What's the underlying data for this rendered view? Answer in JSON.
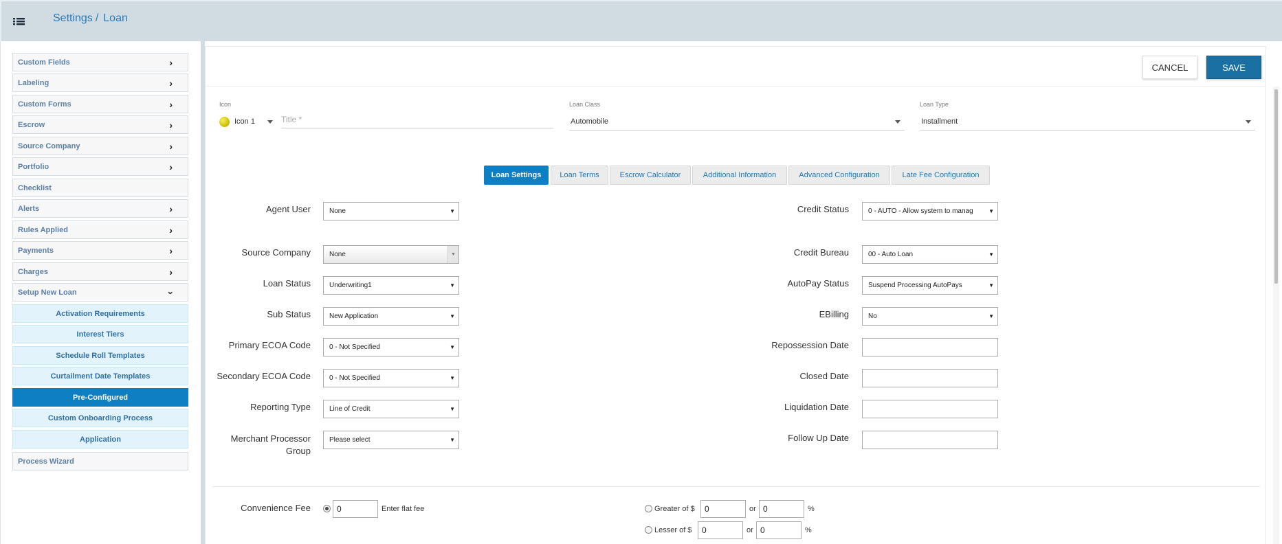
{
  "header": {
    "breadcrumb": [
      "Settings",
      "Loan"
    ],
    "breadcrumb_sep": "/"
  },
  "sidebar": {
    "items": [
      {
        "label": "Custom Fields",
        "chevron": "right"
      },
      {
        "label": "Labeling",
        "chevron": "right"
      },
      {
        "label": "Custom Forms",
        "chevron": "right"
      },
      {
        "label": "Escrow",
        "chevron": "right"
      },
      {
        "label": "Source Company",
        "chevron": "right"
      },
      {
        "label": "Portfolio",
        "chevron": "right"
      },
      {
        "label": "Checklist",
        "chevron": ""
      },
      {
        "label": "Alerts",
        "chevron": "right"
      },
      {
        "label": "Rules Applied",
        "chevron": "right"
      },
      {
        "label": "Payments",
        "chevron": "right"
      },
      {
        "label": "Charges",
        "chevron": "right"
      },
      {
        "label": "Setup New Loan",
        "chevron": "down"
      }
    ],
    "subitems": [
      {
        "label": "Activation Requirements"
      },
      {
        "label": "Interest Tiers"
      },
      {
        "label": "Schedule Roll Templates"
      },
      {
        "label": "Curtailment Date Templates"
      },
      {
        "label": "Pre-Configured",
        "active": true
      },
      {
        "label": "Custom Onboarding Process"
      },
      {
        "label": "Application"
      }
    ],
    "last_item": "Process Wizard"
  },
  "actions": {
    "cancel": "CANCEL",
    "save": "SAVE"
  },
  "top_fields": {
    "icon_label": "Icon",
    "icon_value": "Icon 1",
    "title_placeholder": "Title *",
    "loan_class_label": "Loan Class",
    "loan_class_value": "Automobile",
    "loan_type_label": "Loan Type",
    "loan_type_value": "Installment"
  },
  "tabs": [
    {
      "label": "Loan Settings",
      "active": true
    },
    {
      "label": "Loan Terms"
    },
    {
      "label": "Escrow Calculator"
    },
    {
      "label": "Additional Information"
    },
    {
      "label": "Advanced Configuration"
    },
    {
      "label": "Late Fee Configuration"
    }
  ],
  "left_form": [
    {
      "label": "Agent User",
      "value": "None"
    },
    {
      "label": "Source Company",
      "value": "None"
    },
    {
      "label": "Loan Status",
      "value": "Underwriting1"
    },
    {
      "label": "Sub Status",
      "value": "New Application"
    },
    {
      "label": "Primary ECOA Code",
      "value": "0 - Not Specified"
    },
    {
      "label": "Secondary ECOA Code",
      "value": "0 - Not Specified"
    },
    {
      "label": "Reporting Type",
      "value": "Line of Credit"
    },
    {
      "label": "Merchant Processor",
      "label2": "Group",
      "value": "Please select"
    }
  ],
  "right_form": [
    {
      "label": "Credit Status",
      "value": "0 - AUTO - Allow system to manag"
    },
    {
      "label": "Credit Bureau",
      "value": "00 - Auto Loan"
    },
    {
      "label": "AutoPay Status",
      "value": "Suspend Processing AutoPays"
    },
    {
      "label": "EBilling",
      "value": "No"
    },
    {
      "label": "Repossession Date",
      "value": ""
    },
    {
      "label": "Closed Date",
      "value": ""
    },
    {
      "label": "Liquidation Date",
      "value": ""
    },
    {
      "label": "Follow Up Date",
      "value": ""
    }
  ],
  "convenience_fee": {
    "label": "Convenience Fee",
    "flat_value": "0",
    "flat_text": "Enter flat fee",
    "greater_text": "Greater of $",
    "greater_amount": "0",
    "greater_pct": "0",
    "lesser_text": "Lesser of $",
    "lesser_amount": "0",
    "lesser_pct": "0",
    "or_text": "or",
    "pct_sign": "%"
  },
  "colors": {
    "topbar": "#d0dbe2",
    "accent": "#0e7fc2",
    "save": "#1a6fa3",
    "link": "#2a7ab8"
  }
}
